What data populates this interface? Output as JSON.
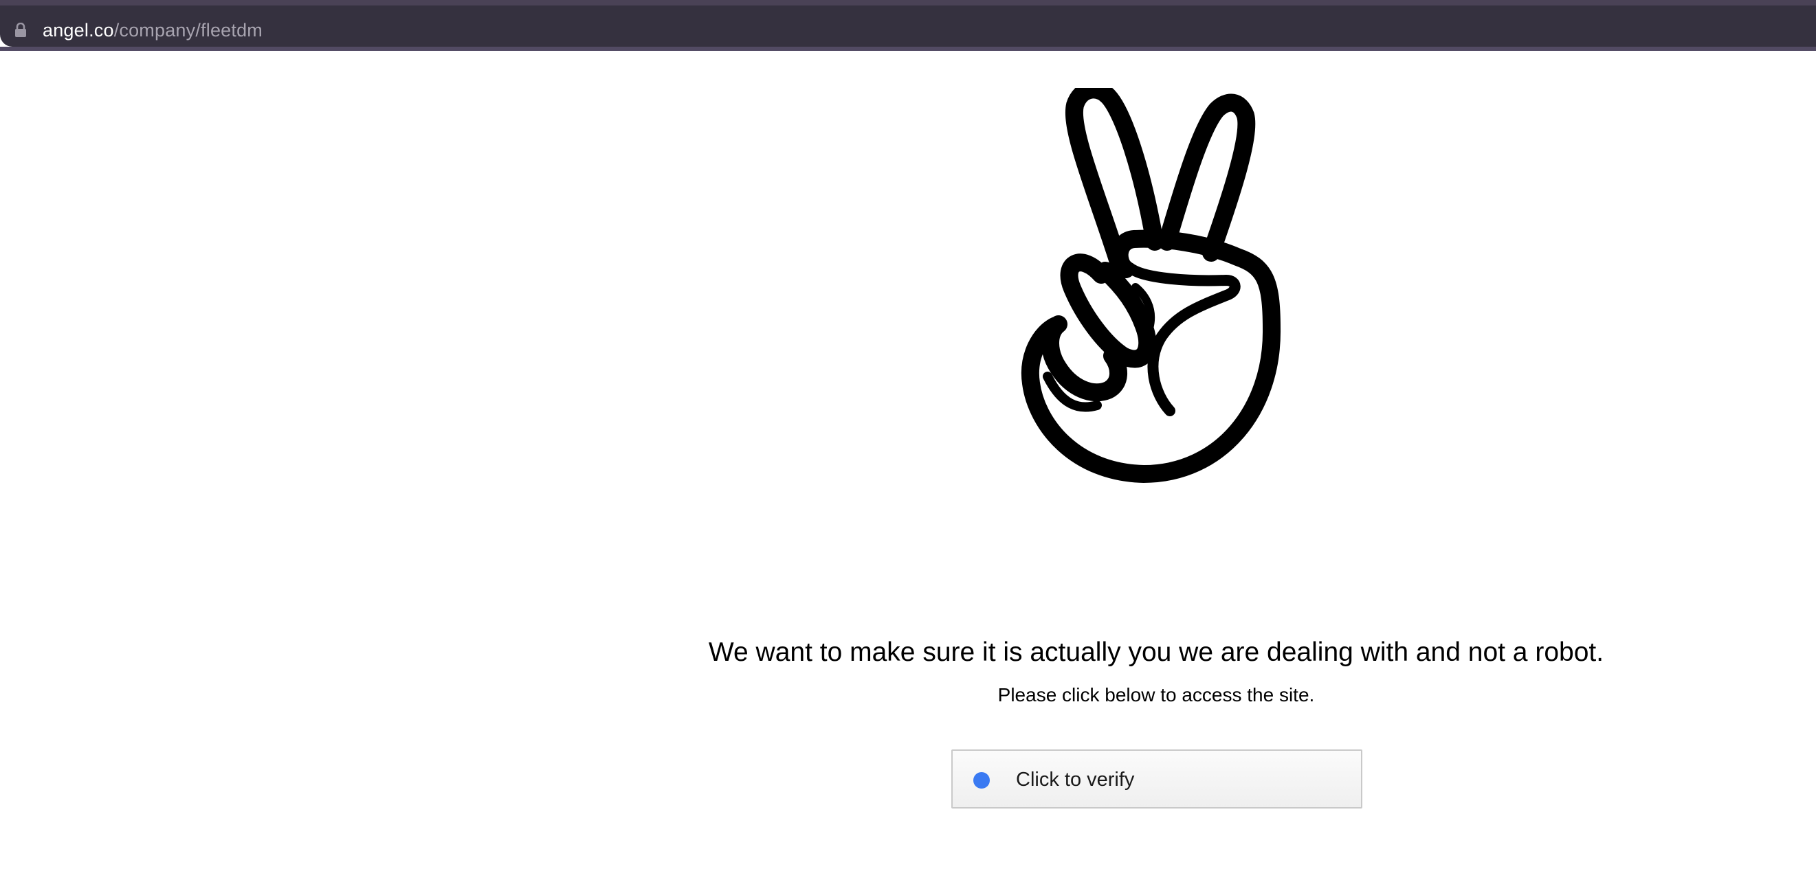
{
  "browser": {
    "url_host": "angel.co",
    "url_path": "/company/fleetdm",
    "lock_icon": "lock-icon"
  },
  "main": {
    "logo_icon": "peace-hand-logo",
    "headline": "We want to make sure it is actually you we are dealing with and not a robot.",
    "subline": "Please click below to access the site.",
    "verify_label": "Click to verify",
    "verify_dot_color": "#3a7af2"
  }
}
